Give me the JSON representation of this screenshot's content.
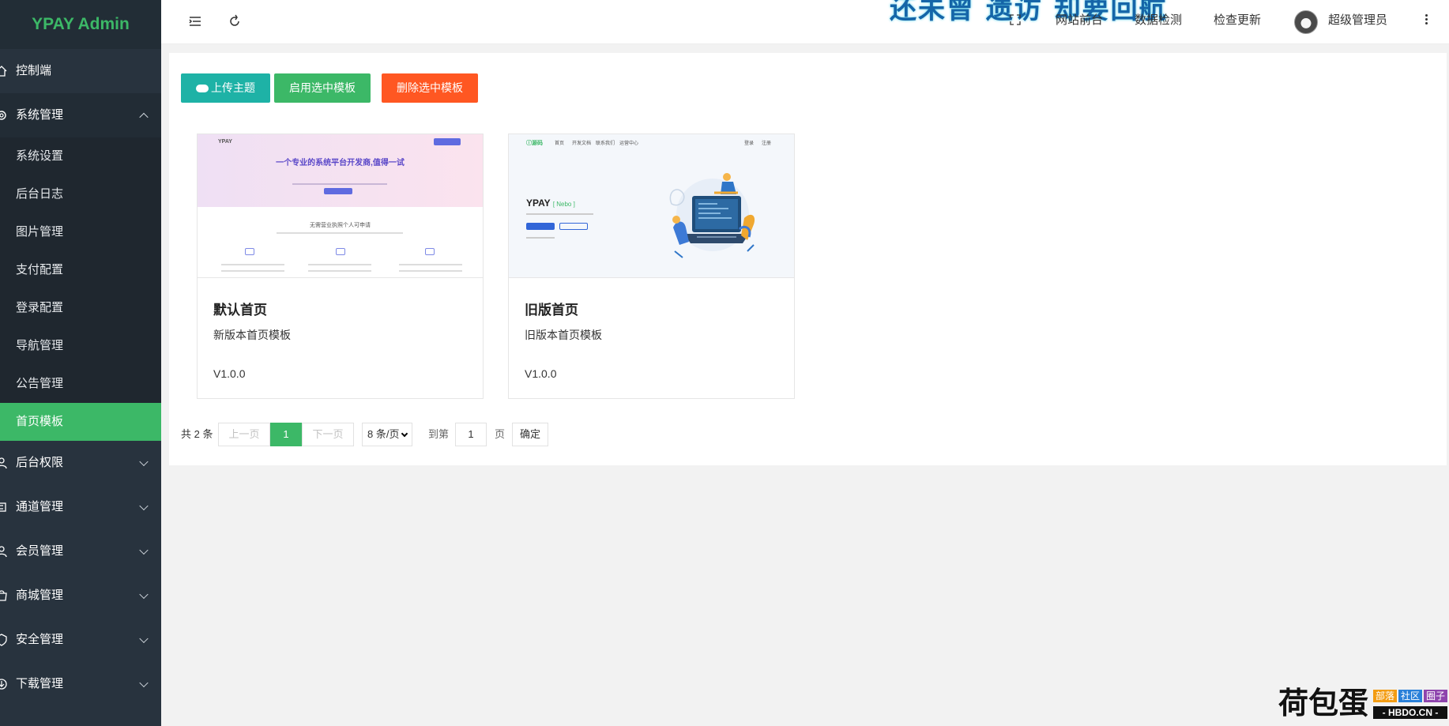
{
  "sidebar": {
    "logo": "YPAY Admin",
    "dashboard": "控制端",
    "system_group": "系统管理",
    "system_items": [
      "系统设置",
      "后台日志",
      "图片管理",
      "支付配置",
      "登录配置",
      "导航管理",
      "公告管理",
      "首页模板"
    ],
    "groups": [
      "后台权限",
      "通道管理",
      "会员管理",
      "商城管理",
      "安全管理",
      "下载管理"
    ],
    "accent_color": "#3cb867"
  },
  "header": {
    "banner": "还未曾 遗访 却要回航",
    "links": [
      "网站前台",
      "数据检测",
      "检查更新"
    ],
    "user_name": "超级管理员"
  },
  "toolbar": {
    "upload_label": "上传主题",
    "enable_label": "启用选中模板",
    "delete_label": "删除选中模板"
  },
  "templates": [
    {
      "name": "默认首页",
      "desc": "新版本首页模板",
      "version": "V1.0.0",
      "preview": {
        "nav": "YPAY",
        "headline": "一个专业的系统平台开发商,值得一试",
        "section": "无需营业执照个人可申请"
      }
    },
    {
      "name": "旧版首页",
      "desc": "旧版本首页模板",
      "version": "V1.0.0",
      "preview": {
        "logo": "ⓘ源码",
        "nav": [
          "首页",
          "开发文档",
          "联系我们",
          "运营中心"
        ],
        "nav_right": [
          "登录",
          "注册"
        ],
        "brand": "YPAY",
        "brand_tag": "[ Nebo ]"
      }
    }
  ],
  "pagination": {
    "total": "共 2 条",
    "prev": "上一页",
    "current": "1",
    "next": "下一页",
    "page_size": "8 条/页",
    "goto_label": "到第",
    "goto_value": "1",
    "page_unit": "页",
    "confirm": "确定"
  },
  "watermark": {
    "main": "荷包蛋",
    "tags": [
      "部落",
      "社区",
      "圈子"
    ],
    "url": "- HBDO.CN -"
  }
}
